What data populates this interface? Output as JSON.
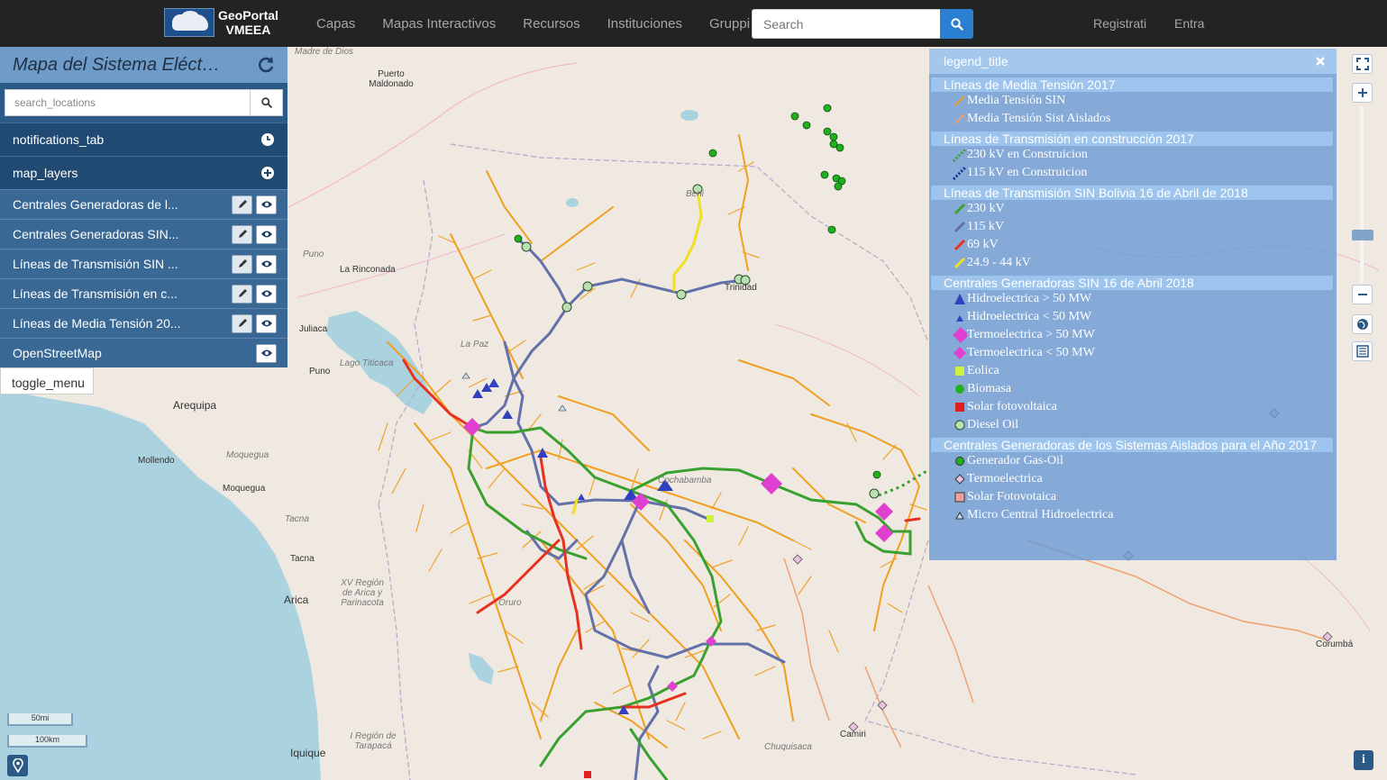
{
  "navbar": {
    "brand_line1": "GeoPortal",
    "brand_line2": "VMEEA",
    "links": [
      "Capas",
      "Mapas Interactivos",
      "Recursos",
      "Instituciones",
      "Gruppi"
    ],
    "search_placeholder": "Search",
    "register": "Registrati",
    "login": "Entra"
  },
  "panel": {
    "title": "Mapa del Sistema Eléct…",
    "search_placeholder": "search_locations",
    "notifications": "notifications_tab",
    "map_layers": "map_layers",
    "layers": [
      "Centrales Generadoras de l...",
      "Centrales Generadoras SIN...",
      "Líneas de Transmisión SIN ...",
      "Líneas de Transmisión en c...",
      "Líneas de Media Tensión 20..."
    ],
    "base_layer": "OpenStreetMap",
    "toggle_menu": "toggle_menu"
  },
  "legend": {
    "title": "legend_title",
    "sec1": "Líneas de Media Tensión 2017",
    "sec1_items": [
      "Media Tensión SIN",
      "Media Tensión Sist Aislados"
    ],
    "sec2": "Líneas de Transmisión en construcción 2017",
    "sec2_items": [
      "230 kV en Construicion",
      "115 kV en Construicion"
    ],
    "sec3": "Líneas de Transmisión SIN Bolivia 16 de Abril de 2018",
    "sec3_items": [
      "230 kV",
      "115 kV",
      "69 kV",
      "24.9 - 44 kV"
    ],
    "sec4": "Centrales Generadoras SIN 16 de Abril 2018",
    "sec4_items": [
      "Hidroelectrica > 50 MW",
      "Hidroelectrica < 50 MW",
      "Termoelectrica > 50 MW",
      "Termoelectrica < 50 MW",
      "Eolica",
      "Biomasa",
      "Solar fotovoltaica",
      "Diesel Oil"
    ],
    "sec5": "Centrales Generadoras de los Sistemas Aislados para el Año 2017",
    "sec5_items": [
      "Generador Gas-Oil",
      "Termoelectrica",
      "Solar Fotovotaica",
      "Micro Central Hidroelectrica"
    ]
  },
  "colors": {
    "mt_sin": "#f0a020",
    "mt_aislados": "#f0a070",
    "kv230": "#3aa030",
    "kv115": "#6470a8",
    "kv69": "#e83020",
    "kv24": "#f0e020",
    "hidro": "#3040c0",
    "termo": "#e040d0",
    "eolica": "#d0f040",
    "biomasa": "#20b020",
    "solar": "#e02020",
    "diesel": "#b8e0b0"
  },
  "places": [
    "Puerto Maldonado",
    "Puno",
    "La Rinconada",
    "Juliaca",
    "Lago Titicaca",
    "Puno",
    "Arequipa",
    "Mollendo",
    "Moquegua",
    "Moquegua",
    "Tacna",
    "Tacna",
    "Arica",
    "XV Región de Arica y Parinacota",
    "Iquique",
    "I Región de Tarapacá",
    "Oruro",
    "La Paz",
    "Beni",
    "Trinidad",
    "Cochabamba",
    "Chuquisaca",
    "Camiri",
    "Corumbá",
    "Madre de Dios"
  ],
  "scale": [
    "50mi",
    "100km"
  ],
  "info": "i"
}
